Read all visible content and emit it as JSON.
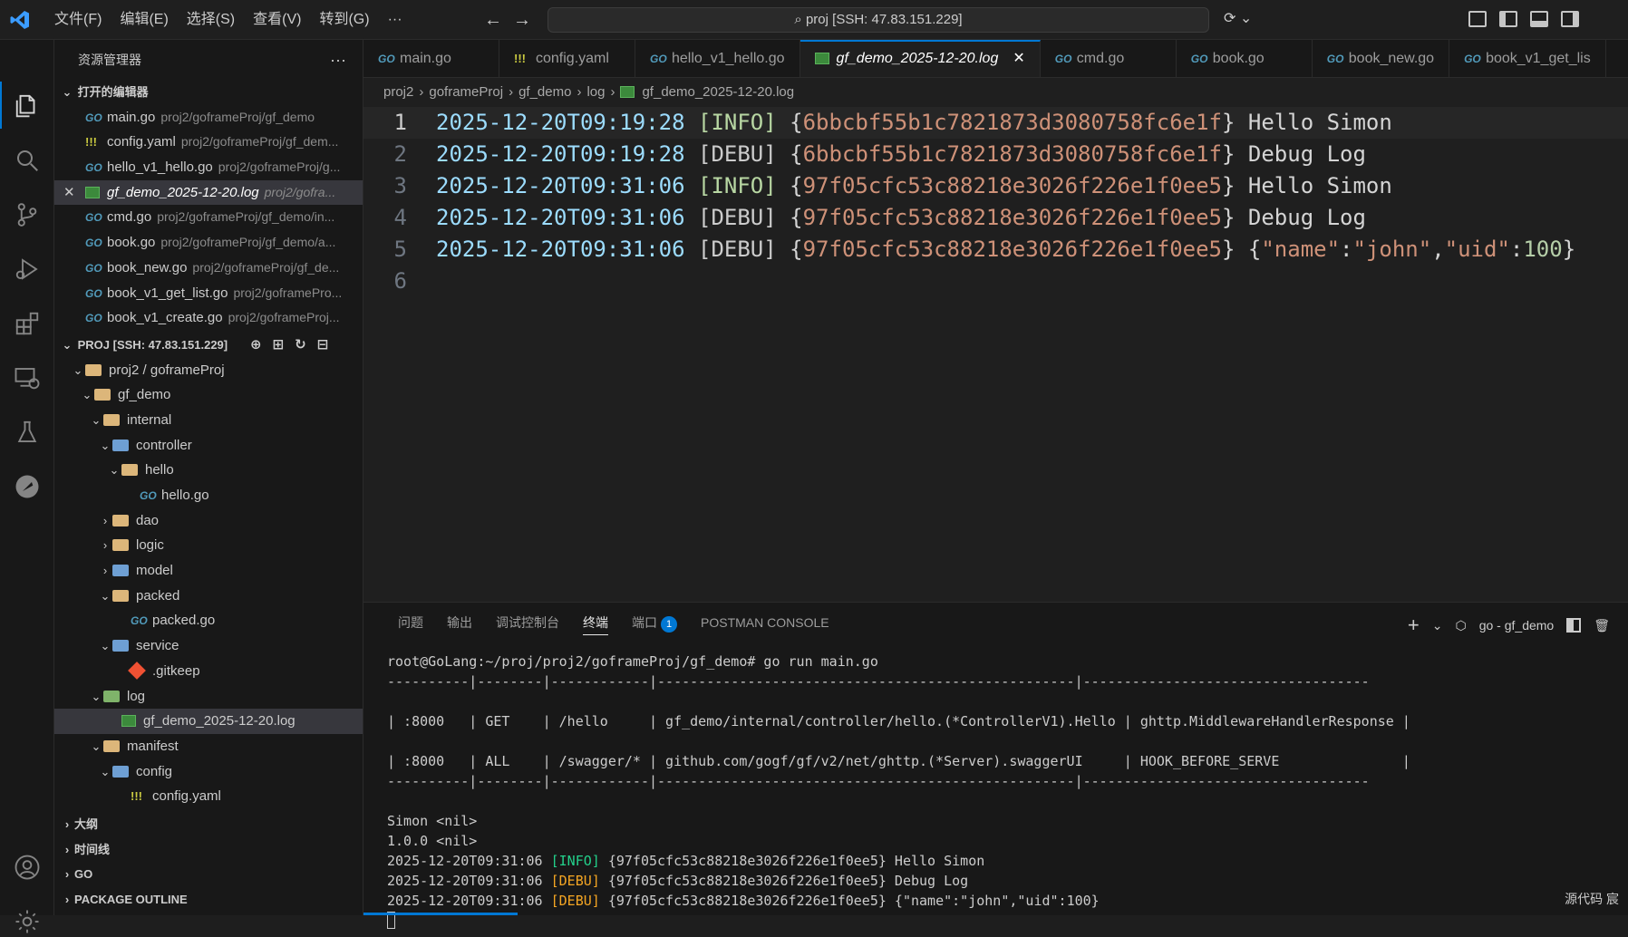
{
  "menu": [
    "文件(F)",
    "编辑(E)",
    "选择(S)",
    "查看(V)",
    "转到(G)",
    "···"
  ],
  "command_center": "proj [SSH: 47.83.151.229]",
  "sidebar": {
    "title": "资源管理器",
    "more": "···",
    "open_editors_label": "打开的编辑器",
    "open_editors": [
      {
        "name": "main.go",
        "path": "proj2/goframeProj/gf_demo",
        "icon": "go"
      },
      {
        "name": "config.yaml",
        "path": "proj2/goframeProj/gf_dem...",
        "icon": "yaml"
      },
      {
        "name": "hello_v1_hello.go",
        "path": "proj2/goframeProj/g...",
        "icon": "go"
      },
      {
        "name": "gf_demo_2025-12-20.log",
        "path": "proj2/gofra...",
        "icon": "log",
        "close": "✕"
      },
      {
        "name": "cmd.go",
        "path": "proj2/goframeProj/gf_demo/in...",
        "icon": "go"
      },
      {
        "name": "book.go",
        "path": "proj2/goframeProj/gf_demo/a...",
        "icon": "go"
      },
      {
        "name": "book_new.go",
        "path": "proj2/goframeProj/gf_de...",
        "icon": "go"
      },
      {
        "name": "book_v1_get_list.go",
        "path": "proj2/goframePro...",
        "icon": "go"
      },
      {
        "name": "book_v1_create.go",
        "path": "proj2/goframeProj...",
        "icon": "go"
      }
    ],
    "project_label": "PROJ [SSH: 47.83.151.229]",
    "tree": [
      {
        "label": "proj2 / goframeProj",
        "depth": 1,
        "chev": "⌄",
        "icon": "folder"
      },
      {
        "label": "gf_demo",
        "depth": 2,
        "chev": "⌄",
        "icon": "folder"
      },
      {
        "label": "internal",
        "depth": 3,
        "chev": "⌄",
        "icon": "folder"
      },
      {
        "label": "controller",
        "depth": 4,
        "chev": "⌄",
        "icon": "folder-blue"
      },
      {
        "label": "hello",
        "depth": 5,
        "chev": "⌄",
        "icon": "folder"
      },
      {
        "label": "hello.go",
        "depth": 7,
        "chev": "",
        "icon": "go"
      },
      {
        "label": "dao",
        "depth": 4,
        "chev": "›",
        "icon": "folder"
      },
      {
        "label": "logic",
        "depth": 4,
        "chev": "›",
        "icon": "folder"
      },
      {
        "label": "model",
        "depth": 4,
        "chev": "›",
        "icon": "folder-blue"
      },
      {
        "label": "packed",
        "depth": 4,
        "chev": "⌄",
        "icon": "folder"
      },
      {
        "label": "packed.go",
        "depth": 6,
        "chev": "",
        "icon": "go"
      },
      {
        "label": "service",
        "depth": 4,
        "chev": "⌄",
        "icon": "folder-blue"
      },
      {
        "label": ".gitkeep",
        "depth": 6,
        "chev": "",
        "icon": "gitkeep"
      },
      {
        "label": "log",
        "depth": 3,
        "chev": "⌄",
        "icon": "folder-green"
      },
      {
        "label": "gf_demo_2025-12-20.log",
        "depth": 5,
        "chev": "",
        "icon": "log"
      },
      {
        "label": "manifest",
        "depth": 3,
        "chev": "⌄",
        "icon": "folder"
      },
      {
        "label": "config",
        "depth": 4,
        "chev": "⌄",
        "icon": "folder-blue"
      },
      {
        "label": "config.yaml",
        "depth": 6,
        "chev": "",
        "icon": "yaml"
      }
    ],
    "bottom_sections": [
      "大纲",
      "时间线",
      "GO",
      "PACKAGE OUTLINE"
    ]
  },
  "tabs": [
    {
      "label": "main.go",
      "icon": "go"
    },
    {
      "label": "config.yaml",
      "icon": "yaml"
    },
    {
      "label": "hello_v1_hello.go",
      "icon": "go"
    },
    {
      "label": "gf_demo_2025-12-20.log",
      "icon": "log",
      "active": true,
      "close": "✕"
    },
    {
      "label": "cmd.go",
      "icon": "go"
    },
    {
      "label": "book.go",
      "icon": "go"
    },
    {
      "label": "book_new.go",
      "icon": "go"
    },
    {
      "label": "book_v1_get_lis",
      "icon": "go"
    }
  ],
  "breadcrumb": [
    "proj2",
    "goframeProj",
    "gf_demo",
    "log",
    "gf_demo_2025-12-20.log"
  ],
  "editor_lines": [
    {
      "n": "1",
      "ts": "2025-12-20T09:19:28",
      "lvl": "[INFO]",
      "id": "6bbcbf55b1c7821873d3080758fc6e1f",
      "msg": "Hello Simon"
    },
    {
      "n": "2",
      "ts": "2025-12-20T09:19:28",
      "lvl": "[DEBU]",
      "id": "6bbcbf55b1c7821873d3080758fc6e1f",
      "msg": "Debug Log"
    },
    {
      "n": "3",
      "ts": "2025-12-20T09:31:06",
      "lvl": "[INFO]",
      "id": "97f05cfc53c88218e3026f226e1f0ee5",
      "msg": "Hello Simon"
    },
    {
      "n": "4",
      "ts": "2025-12-20T09:31:06",
      "lvl": "[DEBU]",
      "id": "97f05cfc53c88218e3026f226e1f0ee5",
      "msg": "Debug Log"
    },
    {
      "n": "5",
      "ts": "2025-12-20T09:31:06",
      "lvl": "[DEBU]",
      "id": "97f05cfc53c88218e3026f226e1f0ee5",
      "msg": "{\"name\":\"john\",\"uid\":100}"
    },
    {
      "n": "6",
      "ts": "",
      "lvl": "",
      "id": "",
      "msg": ""
    }
  ],
  "panel": {
    "tabs": [
      "问题",
      "输出",
      "调试控制台",
      "终端",
      "端口",
      "POSTMAN CONSOLE"
    ],
    "active_tab": "终端",
    "ports_badge": "1",
    "terminal_name": "go - gf_demo",
    "plus": "+"
  },
  "terminal": {
    "prompt": "root@GoLang:~/proj/proj2/goframeProj/gf_demo# go run main.go",
    "lines": [
      "----------|--------|------------|---------------------------------------------------|-----------------------------------",
      "",
      "| :8000   | GET    | /hello     | gf_demo/internal/controller/hello.(*ControllerV1).Hello | ghttp.MiddlewareHandlerResponse |",
      "",
      "| :8000   | ALL    | /swagger/* | github.com/gogf/gf/v2/net/ghttp.(*Server).swaggerUI     | HOOK_BEFORE_SERVE               |",
      "----------|--------|------------|---------------------------------------------------|-----------------------------------",
      "",
      "Simon <nil>",
      "1.0.0 <nil>"
    ],
    "log_lines": [
      {
        "ts": "2025-12-20T09:31:06",
        "lvl": "[INFO]",
        "rest": " {97f05cfc53c88218e3026f226e1f0ee5} Hello Simon"
      },
      {
        "ts": "2025-12-20T09:31:06",
        "lvl": "[DEBU]",
        "rest": " {97f05cfc53c88218e3026f226e1f0ee5} Debug Log"
      },
      {
        "ts": "2025-12-20T09:31:06",
        "lvl": "[DEBU]",
        "rest": " {97f05cfc53c88218e3026f226e1f0ee5} {\"name\":\"john\",\"uid\":100}"
      }
    ]
  },
  "status_right": "源代码  宸"
}
